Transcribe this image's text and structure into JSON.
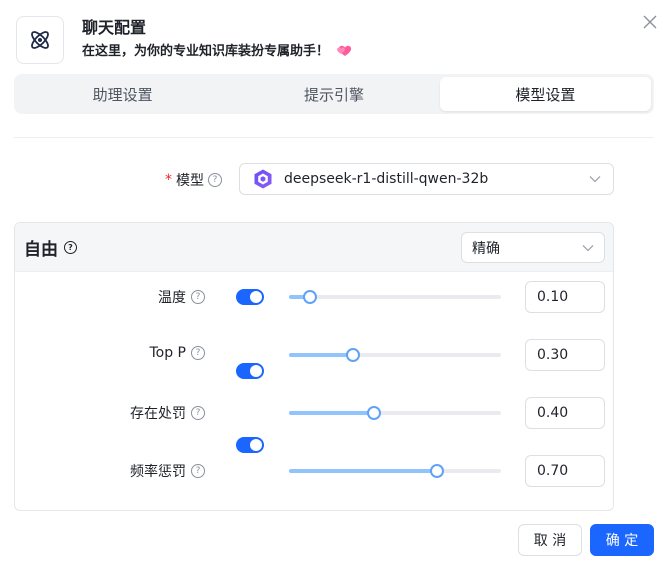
{
  "dialog": {
    "title": "聊天配置",
    "subtitle": "在这里，为你的专业知识库装扮专属助手！",
    "close_icon": "close-icon",
    "logo_icon": "atom-icon",
    "heart_icon": "heart-icon",
    "accent_color": "#1a66ff"
  },
  "tabs": [
    {
      "label": "助理设置",
      "active": false
    },
    {
      "label": "提示引擎",
      "active": false
    },
    {
      "label": "模型设置",
      "active": true
    }
  ],
  "model": {
    "label": "模型",
    "required_mark": "*",
    "help": "?",
    "value": "deepseek-r1-distill-qwen-32b",
    "model_icon": "qwen-logo-icon"
  },
  "params_panel": {
    "title": "自由",
    "help": "?",
    "preset_value": "精确",
    "rows": [
      {
        "label": "温度",
        "help": "?",
        "enabled": true,
        "value": "0.10",
        "fraction": 0.1
      },
      {
        "label": "Top P",
        "help": "?",
        "enabled": true,
        "value": "0.30",
        "fraction": 0.3
      },
      {
        "label": "存在处罚",
        "help": "?",
        "enabled": true,
        "value": "0.40",
        "fraction": 0.4
      },
      {
        "label": "频率惩罚",
        "help": "?",
        "enabled": true,
        "value": "0.70",
        "fraction": 0.7
      }
    ]
  },
  "footer": {
    "cancel_label": "取 消",
    "ok_label": "确 定"
  }
}
